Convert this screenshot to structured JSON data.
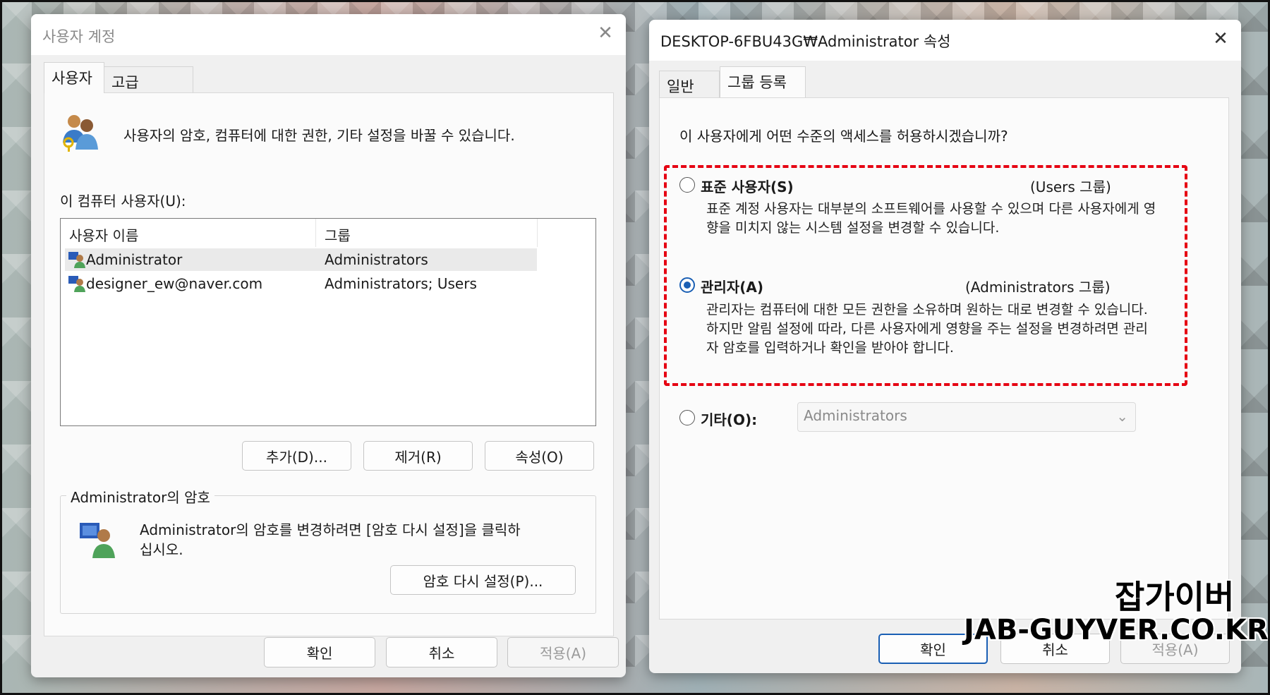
{
  "left_dialog": {
    "title": "사용자 계정",
    "tabs": [
      "사용자",
      "고급"
    ],
    "intro": "사용자의 암호, 컴퓨터에 대한 권한, 기타 설정을 바꿀 수 있습니다.",
    "users_label": "이 컴퓨터 사용자(U):",
    "columns": [
      "사용자 이름",
      "그룹"
    ],
    "rows": [
      {
        "name": "Administrator",
        "group": "Administrators"
      },
      {
        "name": "designer_ew@naver.com",
        "group": "Administrators; Users"
      }
    ],
    "buttons": {
      "add": "추가(D)...",
      "remove": "제거(R)",
      "properties": "속성(O)"
    },
    "password_group": "Administrator의 암호",
    "password_text_1": "Administrator의 암호를 변경하려면 [암호 다시 설정]을 클릭하",
    "password_text_2": "십시오.",
    "reset_button": "암호 다시 설정(P)...",
    "footer": {
      "ok": "확인",
      "cancel": "취소",
      "apply": "적용(A)"
    }
  },
  "right_dialog": {
    "title": "DESKTOP-6FBU43G₩Administrator 속성",
    "tabs": [
      "일반",
      "그룹 등록"
    ],
    "question": "이 사용자에게 어떤 수준의 액세스를 허용하시겠습니까?",
    "options": [
      {
        "label": "표준 사용자(S)",
        "group": "(Users 그룹)",
        "desc": "표준 계정 사용자는 대부분의 소프트웨어를 사용할 수 있으며 다른 사용자에게 영향을 미치지 않는 시스템 설정을 변경할 수 있습니다.",
        "checked": false
      },
      {
        "label": "관리자(A)",
        "group": "(Administrators 그룹)",
        "desc": "관리자는 컴퓨터에 대한 모든 권한을 소유하며 원하는 대로 변경할 수 있습니다. 하지만 알림 설정에 따라, 다른 사용자에게 영향을 주는 설정을 변경하려면 관리자 암호를 입력하거나 확인을 받아야 합니다.",
        "checked": true
      },
      {
        "label": "기타(O):",
        "checked": false
      }
    ],
    "other_combo": "Administrators",
    "footer": {
      "ok": "확인",
      "cancel": "취소",
      "apply": "적용(A)"
    }
  },
  "watermark": {
    "line1": "잡가이버",
    "line2": "JAB-GUYVER.CO.KR"
  },
  "colors": {
    "highlight_border": "#e60012",
    "accent": "#1a5fb4"
  }
}
